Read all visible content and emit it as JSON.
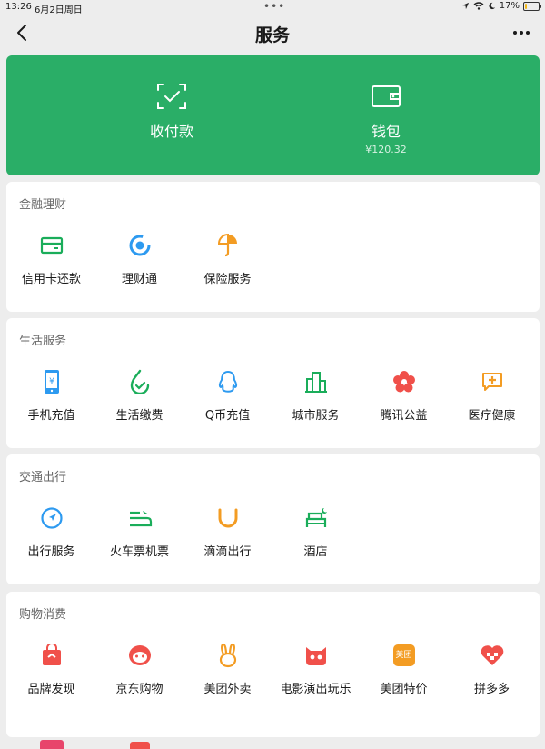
{
  "status_bar": {
    "time": "13:26",
    "date": "6月2日周日",
    "battery": "17%",
    "battery_level": 0.17
  },
  "nav": {
    "title": "服务"
  },
  "hero": {
    "pay_label": "收付款",
    "wallet_label": "钱包",
    "wallet_balance": "¥120.32"
  },
  "sections": {
    "finance": {
      "title": "金融理财",
      "items": [
        {
          "label": "信用卡还款",
          "icon": "credit-card-icon"
        },
        {
          "label": "理财通",
          "icon": "wealth-icon"
        },
        {
          "label": "保险服务",
          "icon": "insurance-icon"
        }
      ]
    },
    "life": {
      "title": "生活服务",
      "items": [
        {
          "label": "手机充值",
          "icon": "phone-icon"
        },
        {
          "label": "生活缴费",
          "icon": "utility-icon"
        },
        {
          "label": "Q币充值",
          "icon": "qq-icon"
        },
        {
          "label": "城市服务",
          "icon": "city-icon"
        },
        {
          "label": "腾讯公益",
          "icon": "charity-icon"
        },
        {
          "label": "医疗健康",
          "icon": "medical-icon"
        }
      ]
    },
    "travel": {
      "title": "交通出行",
      "items": [
        {
          "label": "出行服务",
          "icon": "compass-icon"
        },
        {
          "label": "火车票机票",
          "icon": "train-plane-icon"
        },
        {
          "label": "滴滴出行",
          "icon": "didi-icon"
        },
        {
          "label": "酒店",
          "icon": "hotel-icon"
        }
      ]
    },
    "shopping": {
      "title": "购物消费",
      "items": [
        {
          "label": "品牌发现",
          "icon": "brand-bag-icon"
        },
        {
          "label": "京东购物",
          "icon": "jd-icon"
        },
        {
          "label": "美团外卖",
          "icon": "meituan-waimai-icon"
        },
        {
          "label": "电影演出玩乐",
          "icon": "movie-icon"
        },
        {
          "label": "美团特价",
          "icon": "meituan-icon",
          "badge": "美团"
        },
        {
          "label": "拼多多",
          "icon": "pinduoduo-icon"
        }
      ]
    }
  },
  "colors": {
    "accent": "#2aae67",
    "blue": "#2d9af0",
    "orange": "#f39c23",
    "red": "#f0504a"
  }
}
